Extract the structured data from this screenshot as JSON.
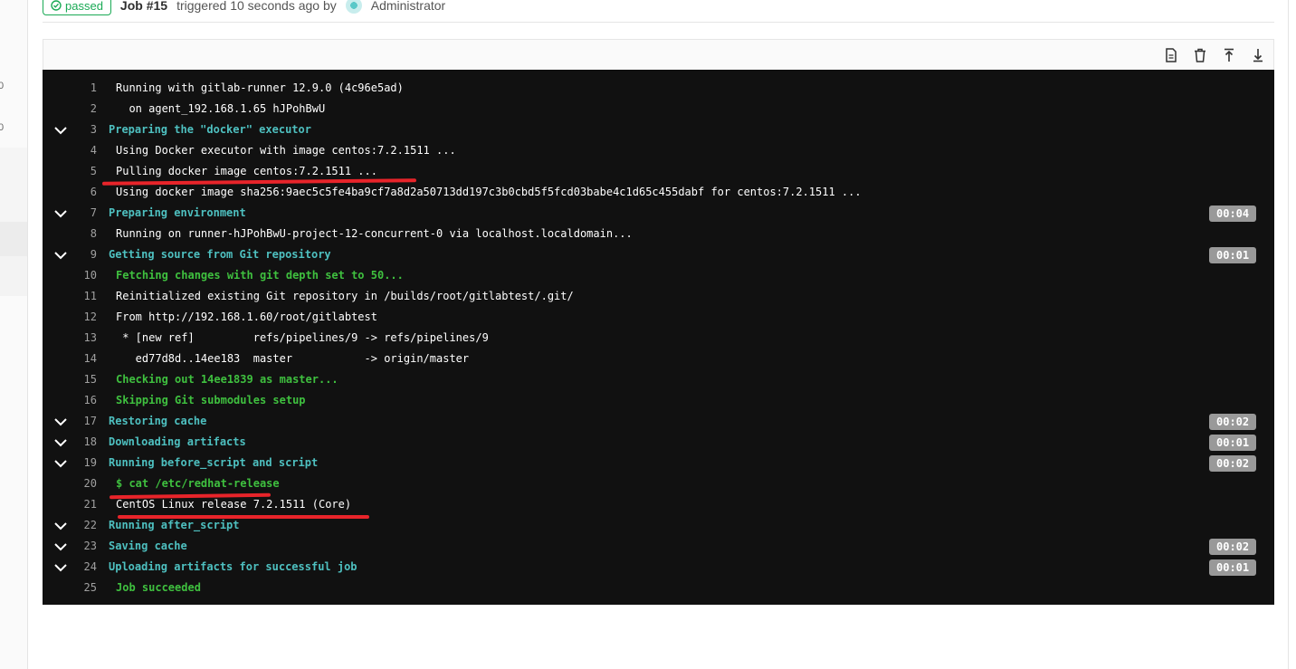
{
  "header": {
    "status": "passed",
    "job_title": "Job #15",
    "triggered_text": "triggered 10 seconds ago by",
    "user": "Administrator"
  },
  "sidebar": {
    "count_1": "0",
    "count_2": "0"
  },
  "toolbar": {
    "icons": [
      "raw-log-icon",
      "erase-log-icon",
      "scroll-top-icon",
      "scroll-bottom-icon"
    ]
  },
  "log": {
    "lines": [
      {
        "n": "1",
        "text": "Running with gitlab-runner 12.9.0 (4c96e5ad)",
        "kind": "plain"
      },
      {
        "n": "2",
        "text": "  on agent_192.168.1.65 hJPohBwU",
        "kind": "plain"
      },
      {
        "n": "3",
        "text": "Preparing the \"docker\" executor",
        "kind": "section"
      },
      {
        "n": "4",
        "text": "Using Docker executor with image centos:7.2.1511 ...",
        "kind": "plain"
      },
      {
        "n": "5",
        "text": "Pulling docker image centos:7.2.1511 ...",
        "kind": "plain"
      },
      {
        "n": "6",
        "text": "Using docker image sha256:9aec5c5fe4ba9cf7a8d2a50713dd197c3b0cbd5f5fcd03babe4c1d65c455dabf for centos:7.2.1511 ...",
        "kind": "plain"
      },
      {
        "n": "7",
        "text": "Preparing environment",
        "kind": "section",
        "duration": "00:04"
      },
      {
        "n": "8",
        "text": "Running on runner-hJPohBwU-project-12-concurrent-0 via localhost.localdomain...",
        "kind": "plain"
      },
      {
        "n": "9",
        "text": "Getting source from Git repository",
        "kind": "section",
        "duration": "00:01"
      },
      {
        "n": "10",
        "text": "Fetching changes with git depth set to 50...",
        "kind": "green"
      },
      {
        "n": "11",
        "text": "Reinitialized existing Git repository in /builds/root/gitlabtest/.git/",
        "kind": "plain"
      },
      {
        "n": "12",
        "text": "From http://192.168.1.60/root/gitlabtest",
        "kind": "plain"
      },
      {
        "n": "13",
        "text": " * [new ref]         refs/pipelines/9 -> refs/pipelines/9",
        "kind": "plain"
      },
      {
        "n": "14",
        "text": "   ed77d8d..14ee183  master           -> origin/master",
        "kind": "plain"
      },
      {
        "n": "15",
        "text": "Checking out 14ee1839 as master...",
        "kind": "green"
      },
      {
        "n": "16",
        "text": "Skipping Git submodules setup",
        "kind": "green"
      },
      {
        "n": "17",
        "text": "Restoring cache",
        "kind": "section",
        "duration": "00:02"
      },
      {
        "n": "18",
        "text": "Downloading artifacts",
        "kind": "section",
        "duration": "00:01"
      },
      {
        "n": "19",
        "text": "Running before_script and script",
        "kind": "section",
        "duration": "00:02"
      },
      {
        "n": "20",
        "text": "$ cat /etc/redhat-release",
        "kind": "green"
      },
      {
        "n": "21",
        "text": "CentOS Linux release 7.2.1511 (Core)",
        "kind": "plain"
      },
      {
        "n": "22",
        "text": "Running after_script",
        "kind": "section"
      },
      {
        "n": "23",
        "text": "Saving cache",
        "kind": "section",
        "duration": "00:02"
      },
      {
        "n": "24",
        "text": "Uploading artifacts for successful job",
        "kind": "section",
        "duration": "00:01"
      },
      {
        "n": "25",
        "text": "Job succeeded",
        "kind": "green"
      }
    ]
  },
  "colors": {
    "section": "#4ec0c0",
    "green": "#3fc03f",
    "annotation": "#e8242a",
    "log_bg": "#111111"
  }
}
